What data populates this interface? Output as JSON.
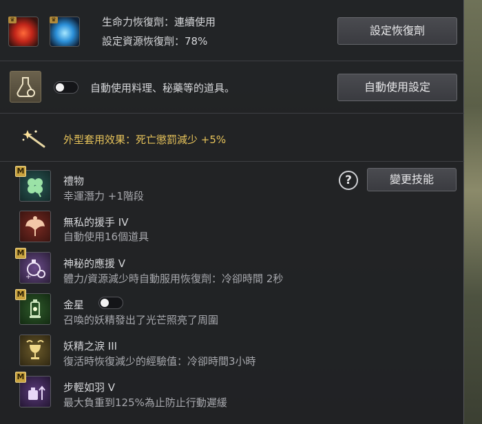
{
  "recovery": {
    "hp_label": "生命力恢復劑：連續使用",
    "resource_label": "設定資源恢復劑：78%",
    "set_button": "設定恢復劑"
  },
  "auto_use": {
    "label": "自動使用料理、秘藥等的道具。",
    "toggle_on": false,
    "settings_button": "自動使用設定"
  },
  "appearance": {
    "effect": "外型套用效果：死亡懲罰減少 +5%"
  },
  "skills": {
    "change_button": "變更技能",
    "help_label": "?",
    "badge": "M",
    "items": [
      {
        "name": "禮物",
        "desc": "幸運潛力 +1階段",
        "icon": "clover-icon",
        "badge": true
      },
      {
        "name": "無私的援手 IV",
        "desc": "自動使用16個道具",
        "icon": "fairy-icon",
        "badge": false
      },
      {
        "name": "神秘的應援 V",
        "desc": "體力/資源減少時自動服用恢復劑：冷卻時間 2秒",
        "icon": "potion-gear-icon",
        "badge": true
      },
      {
        "name": "金星",
        "desc": "召喚的妖精發出了光芒照亮了周圍",
        "icon": "lantern-icon",
        "badge": true,
        "toggle_on": false
      },
      {
        "name": "妖精之淚 III",
        "desc": "復活時恢復減少的經驗值：冷卻時間3小時",
        "icon": "chalice-icon",
        "badge": false
      },
      {
        "name": "步輕如羽 V",
        "desc": "最大負重到125%為止防止行動遲緩",
        "icon": "weight-icon",
        "badge": true
      }
    ]
  },
  "colors": {
    "panel": "#202125",
    "gold_text": "#e7c35a",
    "badge": "#c9a33f"
  }
}
